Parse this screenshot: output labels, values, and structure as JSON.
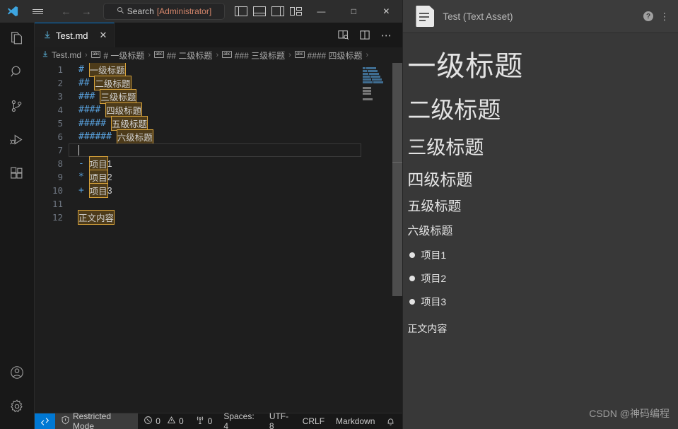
{
  "titlebar": {
    "logo_icon": "vscode-logo-icon",
    "menu_icon": "hamburger-menu-icon",
    "back_icon": "←",
    "forward_icon": "→",
    "search": {
      "icon": "search-icon",
      "text": "Search ",
      "admin": "[Administrator]",
      "full": "Search [Administrator]"
    },
    "layout_icons": [
      "toggle-primary-sidebar-icon",
      "toggle-panel-icon",
      "toggle-secondary-sidebar-icon",
      "customize-layout-icon"
    ],
    "window_controls": {
      "minimize": "—",
      "maximize": "□",
      "close": "✕"
    }
  },
  "activitybar": {
    "items": [
      {
        "name": "explorer",
        "icon": "files-icon"
      },
      {
        "name": "search",
        "icon": "search-icon"
      },
      {
        "name": "source-control",
        "icon": "source-control-icon"
      },
      {
        "name": "run-debug",
        "icon": "run-and-debug-icon"
      },
      {
        "name": "extensions",
        "icon": "extensions-icon"
      }
    ],
    "bottom_items": [
      {
        "name": "accounts",
        "icon": "account-icon"
      },
      {
        "name": "manage",
        "icon": "gear-icon"
      }
    ]
  },
  "tabs": {
    "active": {
      "label": "Test.md",
      "icon": "markdown-file-icon",
      "close_icon": "✕"
    },
    "actions": [
      {
        "name": "open-preview-to-the-side",
        "icon": "preview-icon"
      },
      {
        "name": "split-editor-right",
        "icon": "split-editor-icon"
      },
      {
        "name": "more-actions",
        "icon": "ellipsis-icon",
        "glyph": "⋯"
      }
    ]
  },
  "breadcrumb": {
    "separator": "›",
    "items": [
      {
        "label": "Test.md",
        "icon": "markdown-file-icon"
      },
      {
        "label": "# 一级标题",
        "icon": "symbol-string-icon"
      },
      {
        "label": "## 二级标题",
        "icon": "symbol-string-icon"
      },
      {
        "label": "### 三级标题",
        "icon": "symbol-string-icon"
      },
      {
        "label": "#### 四级标题",
        "icon": "symbol-string-icon"
      }
    ]
  },
  "editor": {
    "lines": [
      {
        "num": "1",
        "marker": "#",
        "text": "一级标题",
        "suffix": "",
        "highlight": true,
        "type": "heading"
      },
      {
        "num": "2",
        "marker": "##",
        "text": "二级标题",
        "suffix": "",
        "highlight": true,
        "type": "heading"
      },
      {
        "num": "3",
        "marker": "###",
        "text": "三级标题",
        "suffix": "",
        "highlight": true,
        "type": "heading"
      },
      {
        "num": "4",
        "marker": "####",
        "text": "四级标题",
        "suffix": "",
        "highlight": true,
        "type": "heading"
      },
      {
        "num": "5",
        "marker": "#####",
        "text": "五级标题",
        "suffix": "",
        "highlight": true,
        "type": "heading"
      },
      {
        "num": "6",
        "marker": "######",
        "text": "六级标题",
        "suffix": "",
        "highlight": true,
        "type": "heading"
      },
      {
        "num": "7",
        "marker": "",
        "text": "",
        "suffix": "",
        "highlight": false,
        "type": "empty-active"
      },
      {
        "num": "8",
        "marker": "-",
        "text": "项目",
        "suffix": "1",
        "highlight": true,
        "type": "list"
      },
      {
        "num": "9",
        "marker": "*",
        "text": "项目",
        "suffix": "2",
        "highlight": true,
        "type": "list"
      },
      {
        "num": "10",
        "marker": "+",
        "text": "项目",
        "suffix": "3",
        "highlight": true,
        "type": "list"
      },
      {
        "num": "11",
        "marker": "",
        "text": "",
        "suffix": "",
        "highlight": false,
        "type": "empty"
      },
      {
        "num": "12",
        "marker": "",
        "text": "正文内容",
        "suffix": "",
        "highlight": true,
        "type": "paragraph"
      }
    ],
    "colors": {
      "marker": "#569cd6",
      "highlight_bg": "#4d3b1a",
      "highlight_border": "#d7a23a",
      "line_number": "#6e7681",
      "background": "#1e1e1e"
    }
  },
  "statusbar": {
    "remote_icon": "remote-window-icon",
    "restricted": {
      "icon": "shield-icon",
      "label": "Restricted Mode"
    },
    "problems": {
      "error_icon": "error-circle-icon",
      "errors": "0",
      "warning_icon": "warning-triangle-icon",
      "warnings": "0"
    },
    "ports": {
      "icon": "radio-tower-icon",
      "count": "0"
    },
    "indentation": "Spaces: 4",
    "encoding": "UTF-8",
    "eol": "CRLF",
    "language": "Markdown",
    "bell_icon": "notifications-bell-icon"
  },
  "inspector": {
    "icon": "text-asset-icon",
    "title": "Test (Text Asset)",
    "help_icon": "help-icon",
    "help_glyph": "?",
    "kebab_icon": "kebab-menu-icon",
    "kebab_glyph": "⋮",
    "preview": {
      "headings": [
        {
          "level": 1,
          "text": "一级标题"
        },
        {
          "level": 2,
          "text": "二级标题"
        },
        {
          "level": 3,
          "text": "三级标题"
        },
        {
          "level": 4,
          "text": "四级标题"
        },
        {
          "level": 5,
          "text": "五级标题"
        },
        {
          "level": 6,
          "text": "六级标题"
        }
      ],
      "list": [
        {
          "text": "项目1"
        },
        {
          "text": "项目2"
        },
        {
          "text": "项目3"
        }
      ],
      "paragraph": "正文内容"
    }
  },
  "watermark": "CSDN @神码编程"
}
